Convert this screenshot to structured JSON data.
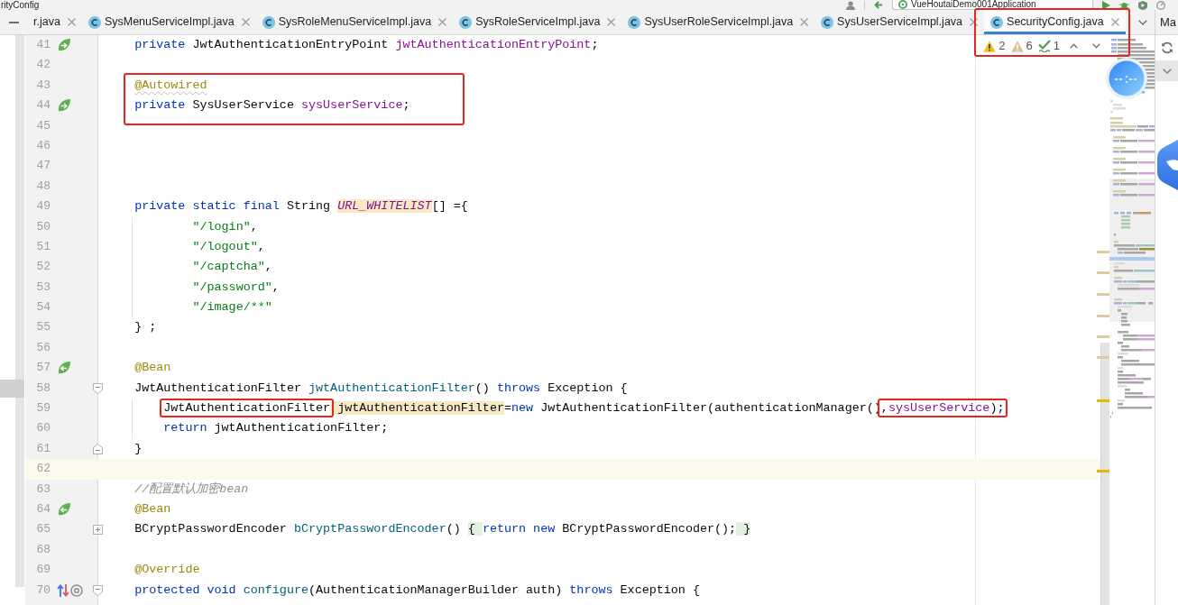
{
  "navigation_bar": {
    "breadcrumb": "rityConfig",
    "run_configuration": "VueHoutaiDemo001Application"
  },
  "tabs": [
    {
      "label": "r.java",
      "icon": false,
      "selected": false,
      "boxed": false
    },
    {
      "label": "SysMenuServiceImpl.java",
      "icon": true,
      "selected": false,
      "boxed": false
    },
    {
      "label": "SysRoleMenuServiceImpl.java",
      "icon": true,
      "selected": false,
      "boxed": false
    },
    {
      "label": "SysRoleServiceImpl.java",
      "icon": true,
      "selected": false,
      "boxed": false
    },
    {
      "label": "SysUserRoleServiceImpl.java",
      "icon": true,
      "selected": false,
      "boxed": false
    },
    {
      "label": "SysUserServiceImpl.java",
      "icon": true,
      "selected": false,
      "boxed": false
    },
    {
      "label": "SecurityConfig.java",
      "icon": true,
      "selected": true,
      "boxed": true
    }
  ],
  "tool_window": {
    "title": "Ma"
  },
  "inspections": {
    "boxed": true,
    "items": [
      {
        "kind": "warning",
        "count": "2"
      },
      {
        "kind": "weak_warning",
        "count": "6"
      },
      {
        "kind": "typo",
        "count": "1"
      }
    ]
  },
  "editor": {
    "lines": [
      {
        "number": "41",
        "current": false,
        "gutter_icons": [
          {
            "kind": "bean_inject"
          }
        ],
        "tokens": [
          {
            "text": "private",
            "kind": "keyword"
          },
          {
            "text": " JwtAuthenticationEntryPoint ",
            "kind": "plain"
          },
          {
            "text": "jwtAuthenticationEntryPoint",
            "kind": "field"
          },
          {
            "text": ";",
            "kind": "plain"
          }
        ]
      },
      {
        "number": "42",
        "current": false
      },
      {
        "number": "43",
        "current": false,
        "boxed": true,
        "tokens": [
          {
            "text": "@Autowired",
            "kind": "annotation",
            "weak_warning": true
          }
        ]
      },
      {
        "number": "44",
        "current": false,
        "boxed": true,
        "gutter_icons": [
          {
            "kind": "bean_inject"
          }
        ],
        "tokens": [
          {
            "text": "private",
            "kind": "keyword"
          },
          {
            "text": " SysUserService ",
            "kind": "plain"
          },
          {
            "text": "sysUserService",
            "kind": "field"
          },
          {
            "text": ";",
            "kind": "plain"
          }
        ]
      },
      {
        "number": "45",
        "current": false
      },
      {
        "number": "46",
        "current": false
      },
      {
        "number": "47",
        "current": false
      },
      {
        "number": "48",
        "current": false
      },
      {
        "number": "49",
        "current": false,
        "continuation": true,
        "tokens": [
          {
            "text": "private static final",
            "kind": "keyword"
          },
          {
            "text": " String ",
            "kind": "plain"
          },
          {
            "text": "URL_WHITELIST",
            "kind": "constant",
            "warning": true
          },
          {
            "text": "[] ={",
            "kind": "plain"
          }
        ],
        "children": [
          {
            "number": "50",
            "current": false,
            "tokens": [
              {
                "text": "\"/login\"",
                "kind": "string"
              },
              {
                "text": ",",
                "kind": "plain"
              }
            ]
          },
          {
            "number": "51",
            "current": false,
            "tokens": [
              {
                "text": "\"/logout\"",
                "kind": "string"
              },
              {
                "text": ",",
                "kind": "plain"
              }
            ]
          },
          {
            "number": "52",
            "current": false,
            "tokens": [
              {
                "text": "\"/captcha\"",
                "kind": "string"
              },
              {
                "text": ",",
                "kind": "plain"
              }
            ]
          },
          {
            "number": "53",
            "current": false,
            "tokens": [
              {
                "text": "\"/password\"",
                "kind": "string"
              },
              {
                "text": ",",
                "kind": "plain"
              }
            ]
          },
          {
            "number": "54",
            "current": false,
            "tokens": [
              {
                "text": "\"/image/**\"",
                "kind": "string"
              }
            ]
          }
        ]
      },
      {
        "number": "55",
        "current": false,
        "tokens": [
          {
            "text": "} ;",
            "kind": "plain"
          }
        ]
      },
      {
        "number": "56",
        "current": false
      },
      {
        "number": "57",
        "current": false,
        "gutter_icons": [
          {
            "kind": "bean_provider"
          }
        ],
        "tokens": [
          {
            "text": "@Bean",
            "kind": "annotation"
          }
        ]
      },
      {
        "number": "58",
        "current": false,
        "fold_marker": {
          "kind": "start"
        },
        "continuation": false,
        "tokens": [
          {
            "text": "JwtAuthenticationFilter ",
            "kind": "plain"
          },
          {
            "text": "jwtAuthenticationFilter",
            "kind": "method"
          },
          {
            "text": "() ",
            "kind": "plain"
          },
          {
            "text": "throws",
            "kind": "keyword"
          },
          {
            "text": " Exception {",
            "kind": "plain"
          }
        ],
        "children": [
          {
            "number": "59",
            "current": false,
            "tokens": [
              {
                "text": "JwtAuthenticationFilter",
                "kind": "plain",
                "boxed": true
              },
              {
                "text": " jwtAuthenticationFilter",
                "kind": "plain",
                "warning": true
              },
              {
                "text": "=",
                "kind": "plain"
              },
              {
                "text": "new",
                "kind": "keyword"
              },
              {
                "text": " JwtAuthenticationFilter(authenticationManager()",
                "kind": "plain"
              },
              {
                "text": ",",
                "kind": "plain",
                "boxed": true
              },
              {
                "text": "sysUserService",
                "kind": "field",
                "boxed": true
              },
              {
                "text": ");",
                "kind": "plain",
                "boxed": true
              }
            ]
          },
          {
            "number": "60",
            "current": false,
            "tokens": [
              {
                "text": "return",
                "kind": "keyword"
              },
              {
                "text": " jwtAuthenticationFilter;",
                "kind": "plain"
              }
            ]
          }
        ]
      },
      {
        "number": "61",
        "current": false,
        "fold_marker": {
          "kind": "end"
        },
        "tokens": [
          {
            "text": "}",
            "kind": "plain"
          }
        ]
      },
      {
        "number": "62",
        "current": true
      },
      {
        "number": "63",
        "current": false,
        "tokens": [
          {
            "text": "//配置默认加密bean",
            "kind": "comment"
          }
        ]
      },
      {
        "number": "64",
        "current": false,
        "gutter_icons": [
          {
            "kind": "bean_provider"
          }
        ],
        "tokens": [
          {
            "text": "@Bean",
            "kind": "annotation"
          }
        ]
      },
      {
        "number": "65",
        "current": false,
        "fold_marker": {
          "kind": "collapsed"
        },
        "tokens": [
          {
            "text": "BCryptPasswordEncoder ",
            "kind": "plain"
          },
          {
            "text": "bCryptPasswordEncoder",
            "kind": "method"
          },
          {
            "text": "() ",
            "kind": "plain"
          },
          {
            "text": "{ ",
            "kind": "folded"
          },
          {
            "text": "return new",
            "kind": "keyword"
          },
          {
            "text": " BCryptPasswordEncoder();",
            "kind": "plain"
          },
          {
            "text": " }",
            "kind": "folded"
          }
        ]
      },
      {
        "number": "68",
        "current": false
      },
      {
        "number": "69",
        "current": false,
        "tokens": [
          {
            "text": "@Override",
            "kind": "annotation"
          }
        ]
      },
      {
        "number": "70",
        "current": false,
        "gutter_icons": [
          {
            "kind": "override"
          },
          {
            "kind": "annotation_ref"
          }
        ],
        "fold_marker": {
          "kind": "start"
        },
        "tokens": [
          {
            "text": "protected void ",
            "kind": "keyword"
          },
          {
            "text": "configure",
            "kind": "method"
          },
          {
            "text": "(AuthenticationManagerBuilder auth) ",
            "kind": "plain"
          },
          {
            "text": "throws",
            "kind": "keyword"
          },
          {
            "text": " Exception {",
            "kind": "plain"
          }
        ]
      }
    ]
  }
}
